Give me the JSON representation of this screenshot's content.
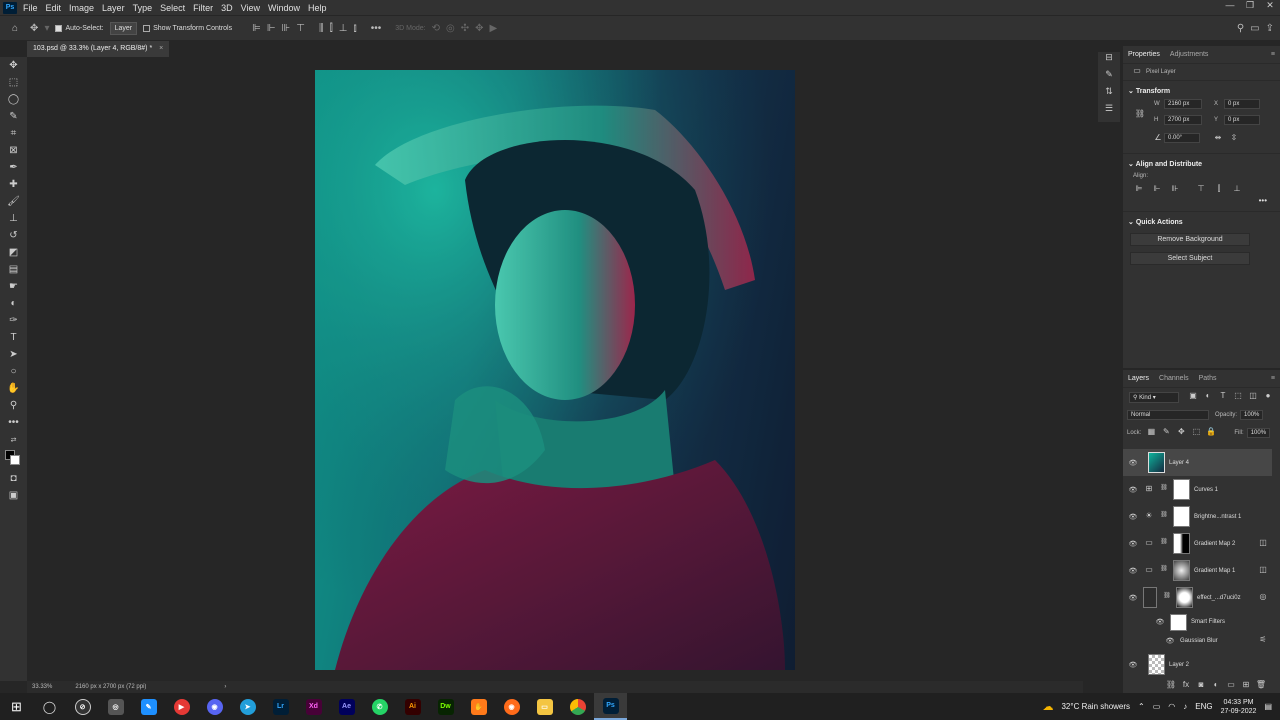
{
  "app": {
    "logo": "Ps"
  },
  "menu": [
    "File",
    "Edit",
    "Image",
    "Layer",
    "Type",
    "Select",
    "Filter",
    "3D",
    "View",
    "Window",
    "Help"
  ],
  "window_controls": [
    "—",
    "❐",
    "✕"
  ],
  "options": {
    "auto_select_label": "Auto-Select:",
    "auto_select_value": "Layer",
    "show_transform_label": "Show Transform Controls",
    "mode_3d_label": "3D Mode:"
  },
  "document_tab": {
    "title": "103.psd @ 33.3% (Layer 4, RGB/8#) *",
    "close": "×"
  },
  "status": {
    "zoom": "33.33%",
    "dims": "2160 px x 2700 px (72 ppi)",
    "arrow": "›"
  },
  "properties": {
    "tabs": [
      "Properties",
      "Adjustments"
    ],
    "pixel_layer": "Pixel Layer",
    "transform": {
      "title": "Transform",
      "w_label": "W",
      "w_value": "2160 px",
      "h_label": "H",
      "h_value": "2700 px",
      "x_label": "X",
      "x_value": "0 px",
      "y_label": "Y",
      "y_value": "0 px",
      "angle_value": "0.00°"
    },
    "align": {
      "title": "Align and Distribute",
      "align_label": "Align:"
    },
    "quick_actions": {
      "title": "Quick Actions",
      "remove_bg": "Remove Background",
      "select_subject": "Select Subject"
    }
  },
  "layers_panel": {
    "tabs": [
      "Layers",
      "Channels",
      "Paths"
    ],
    "kind_label": "Kind",
    "blend_mode": "Normal",
    "opacity_label": "Opacity:",
    "opacity_value": "100%",
    "lock_label": "Lock:",
    "fill_label": "Fill:",
    "fill_value": "100%",
    "layers": [
      {
        "name": "Layer 4",
        "selected": true
      },
      {
        "name": "Curves 1"
      },
      {
        "name": "Brightne...ntrast 1"
      },
      {
        "name": "Gradient Map 2"
      },
      {
        "name": "Gradient Map 1"
      },
      {
        "name": "effect_...d7uci0z"
      },
      {
        "name": "Smart Filters"
      },
      {
        "name": "Gaussian Blur"
      },
      {
        "name": "Layer 2"
      }
    ]
  },
  "taskbar": {
    "apps": [
      "Lr",
      "Xd",
      "Ae",
      "Ai",
      "Dw",
      "Ps"
    ],
    "weather": "32°C  Rain showers",
    "lang": "ENG",
    "time": "04:33 PM",
    "date": "27-09-2022"
  },
  "colors": {
    "accent": "#31a8ff",
    "panel": "#323232",
    "bg": "#262626"
  }
}
